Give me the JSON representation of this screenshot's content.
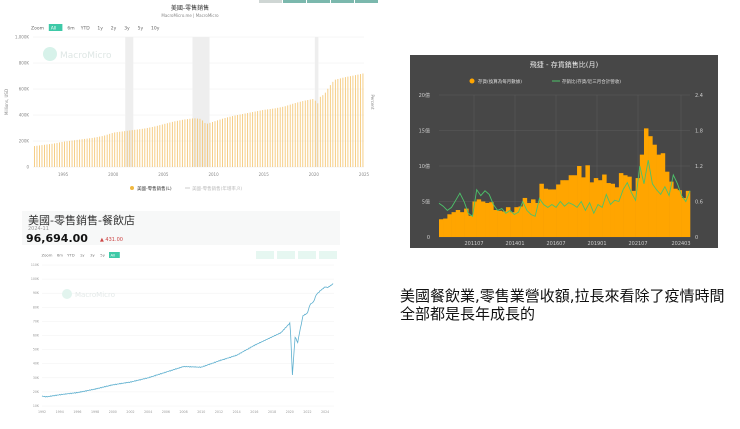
{
  "top_tabs": [
    "",
    "",
    "",
    "",
    ""
  ],
  "note": {
    "line1": "美國餐飲業,零售業營收額,拉長來看除了疫情時間",
    "line2": "全部都是長年成長的"
  },
  "chart_data": [
    {
      "type": "bar",
      "title": "美國-零售銷售",
      "subtitle": "MacroMicro.me | MacroMicro",
      "watermark": "MacroMicro",
      "range_buttons": [
        "Zoom",
        "All",
        "6m",
        "YTD",
        "1y",
        "2y",
        "3y",
        "5y",
        "10y"
      ],
      "active_range": "All",
      "ylabel": "Millions, USD",
      "ylabel_right": "Percent",
      "ylim": [
        0,
        1000000
      ],
      "yticks": [
        "0",
        "200K",
        "400K",
        "600K",
        "800K",
        "1,000K"
      ],
      "xticks": [
        "1995",
        "2000",
        "2005",
        "2010",
        "2015",
        "2020",
        "2025"
      ],
      "xlim": [
        1992,
        2025
      ],
      "legend": [
        "美國-零售銷售(L)",
        "美國-零售銷售(年增率,R)"
      ],
      "recessions": [
        [
          2001.2,
          2001.9
        ],
        [
          2007.9,
          2009.5
        ],
        [
          2020.1,
          2020.35
        ]
      ],
      "series": [
        {
          "name": "美國-零售銷售(L)",
          "x": [
            1992,
            1993,
            1994,
            1995,
            1996,
            1997,
            1998,
            1999,
            2000,
            2001,
            2002,
            2003,
            2004,
            2005,
            2006,
            2007,
            2008,
            2008.7,
            2009.2,
            2010,
            2011,
            2012,
            2013,
            2014,
            2015,
            2016,
            2017,
            2018,
            2019,
            2020,
            2020.3,
            2020.6,
            2021,
            2021.5,
            2022,
            2023,
            2024,
            2024.9
          ],
          "values": [
            160000,
            170000,
            180000,
            195000,
            205000,
            215000,
            225000,
            240000,
            265000,
            275000,
            285000,
            295000,
            310000,
            330000,
            350000,
            365000,
            375000,
            370000,
            330000,
            350000,
            375000,
            395000,
            410000,
            425000,
            440000,
            450000,
            465000,
            490000,
            510000,
            525000,
            480000,
            540000,
            560000,
            620000,
            670000,
            690000,
            705000,
            720000
          ]
        }
      ]
    },
    {
      "type": "line",
      "title": "美國-零售銷售-餐飲店",
      "date": "2024-11",
      "latest_value": "96,694.00",
      "change": "▲ 431.00",
      "watermark": "MacroMicro",
      "range_buttons": [
        "Zoom",
        "6m",
        "YTD",
        "1y",
        "3y",
        "5y",
        "All"
      ],
      "active_range": "All",
      "ylim": [
        10000,
        110000
      ],
      "yticks": [
        "10K",
        "20K",
        "30K",
        "40K",
        "50K",
        "60K",
        "70K",
        "80K",
        "90K",
        "100K",
        "110K"
      ],
      "xlim": [
        1992,
        2025
      ],
      "xticks": [
        "1992",
        "1994",
        "1996",
        "1998",
        "2000",
        "2002",
        "2004",
        "2006",
        "2008",
        "2010",
        "2012",
        "2014",
        "2016",
        "2018",
        "2020",
        "2022",
        "2024"
      ],
      "series": [
        {
          "name": "美國-零售銷售-餐飲店",
          "x": [
            1992,
            1992.5,
            1994,
            1996,
            1998,
            2000,
            2002,
            2004,
            2006,
            2008,
            2010,
            2012,
            2014,
            2016,
            2018,
            2019,
            2020.05,
            2020.3,
            2020.6,
            2020.9,
            2021.1,
            2021.5,
            2022,
            2022.3,
            2022.7,
            2023,
            2023.5,
            2024,
            2024.3,
            2024.9
          ],
          "values": [
            17000,
            16500,
            18000,
            19500,
            22000,
            25000,
            27000,
            30000,
            34000,
            38000,
            37500,
            42000,
            46000,
            53000,
            59000,
            62000,
            69000,
            32000,
            59000,
            55000,
            62000,
            74000,
            76000,
            82000,
            84000,
            89000,
            92000,
            94500,
            94000,
            96694
          ]
        }
      ]
    },
    {
      "type": "bar",
      "title": "飛捷 - 存貨銷售比(月)",
      "legend": [
        "存貨(換算為每月數據)",
        "存銷比(存貨/近三月合計營收)"
      ],
      "yticks_left": [
        "0",
        "5億",
        "10億",
        "15億",
        "20億"
      ],
      "yticks_right": [
        "0",
        "0.6",
        "1.2",
        "1.8",
        "2.4"
      ],
      "ylim_left": [
        0,
        20
      ],
      "ylim_right": [
        0,
        2.4
      ],
      "xticks": [
        "201107",
        "201401",
        "201607",
        "201901",
        "202107",
        "202403"
      ],
      "series": [
        {
          "name": "存貨(換算為每月數據)",
          "unit": "億",
          "values": [
            2.5,
            2.6,
            3.2,
            3.5,
            3.8,
            3.5,
            4.0,
            3.0,
            5.0,
            5.3,
            5.0,
            4.8,
            4.9,
            3.8,
            3.7,
            3.6,
            4.2,
            3.5,
            4.2,
            4.3,
            5.5,
            4.8,
            5.3,
            4.8,
            7.5,
            6.8,
            6.7,
            6.7,
            7.4,
            8.0,
            8.0,
            8.7,
            8.7,
            10.0,
            8.4,
            10.1,
            7.7,
            8.3,
            8.0,
            8.8,
            7.6,
            7.5,
            7.0,
            9.0,
            8.7,
            8.5,
            6.5,
            8.3,
            11.6,
            15.3,
            14.2,
            13.0,
            11.6,
            11.8,
            9.2,
            7.8,
            6.8,
            6.6,
            5.5,
            6.5
          ]
        },
        {
          "name": "存銷比(存貨/近三月合計營收)",
          "values": [
            0.57,
            0.52,
            0.45,
            0.5,
            0.62,
            0.74,
            0.6,
            0.4,
            0.35,
            0.8,
            0.7,
            0.78,
            0.72,
            0.55,
            0.45,
            0.48,
            0.4,
            0.45,
            0.38,
            0.42,
            0.6,
            0.45,
            0.38,
            0.35,
            0.65,
            0.55,
            0.5,
            0.55,
            0.5,
            0.6,
            0.52,
            0.58,
            0.55,
            0.5,
            0.6,
            0.45,
            0.58,
            0.4,
            0.55,
            0.5,
            0.72,
            0.55,
            0.62,
            0.6,
            0.8,
            0.92,
            0.75,
            0.62,
            1.2,
            0.9,
            1.3,
            0.9,
            0.8,
            0.72,
            0.85,
            0.7,
            1.05,
            0.9,
            0.7,
            0.6,
            0.78
          ]
        }
      ]
    }
  ]
}
